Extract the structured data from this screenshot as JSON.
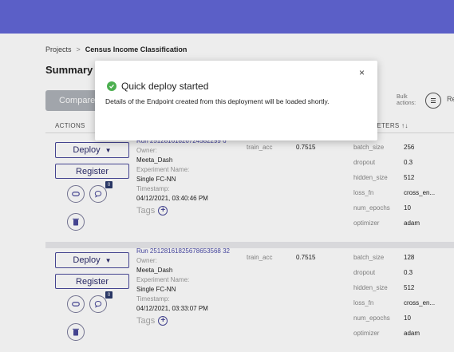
{
  "breadcrumb": {
    "root": "Projects",
    "separator": ">",
    "current": "Census Income Classification"
  },
  "page": {
    "title": "Summary"
  },
  "toolbar": {
    "compare_label": "Compare",
    "bulk_label": "Bulk actions:",
    "truncated_label": "Re"
  },
  "table": {
    "actions_header": "ACTIONS",
    "params_header": "PARAMETERS ↑↓"
  },
  "modal": {
    "title": "Quick deploy started",
    "body": "Details of the Endpoint created from this deployment will be loaded shortly.",
    "close": "×"
  },
  "runs": [
    {
      "deploy_label": "Deploy",
      "register_label": "Register",
      "comment_count": "0",
      "run_name": "Run 25128161826724582299 6",
      "owner_label": "Owner:",
      "owner": "Meeta_Dash",
      "experiment_label": "Experiment Name:",
      "experiment": "Single FC-NN",
      "timestamp_label": "Timestamp:",
      "timestamp": "04/12/2021, 03:40:46 PM",
      "tags_label": "Tags",
      "metric_name": "train_acc",
      "metric_value": "0.7515",
      "params": [
        {
          "key": "batch_size",
          "value": "256"
        },
        {
          "key": "dropout",
          "value": "0.3"
        },
        {
          "key": "hidden_size",
          "value": "512"
        },
        {
          "key": "loss_fn",
          "value": "cross_en..."
        },
        {
          "key": "num_epochs",
          "value": "10"
        },
        {
          "key": "optimizer",
          "value": "adam"
        }
      ]
    },
    {
      "deploy_label": "Deploy",
      "register_label": "Register",
      "comment_count": "0",
      "run_name": "Run 25128161825678653568 32",
      "owner_label": "Owner:",
      "owner": "Meeta_Dash",
      "experiment_label": "Experiment Name:",
      "experiment": "Single FC-NN",
      "timestamp_label": "Timestamp:",
      "timestamp": "04/12/2021, 03:33:07 PM",
      "tags_label": "Tags",
      "metric_name": "train_acc",
      "metric_value": "0.7515",
      "params": [
        {
          "key": "batch_size",
          "value": "128"
        },
        {
          "key": "dropout",
          "value": "0.3"
        },
        {
          "key": "hidden_size",
          "value": "512"
        },
        {
          "key": "loss_fn",
          "value": "cross_en..."
        },
        {
          "key": "num_epochs",
          "value": "10"
        },
        {
          "key": "optimizer",
          "value": "adam"
        }
      ]
    }
  ],
  "colors": {
    "header": "#5b5fc7",
    "accent": "#4a4a9a",
    "success": "#4caf50"
  }
}
